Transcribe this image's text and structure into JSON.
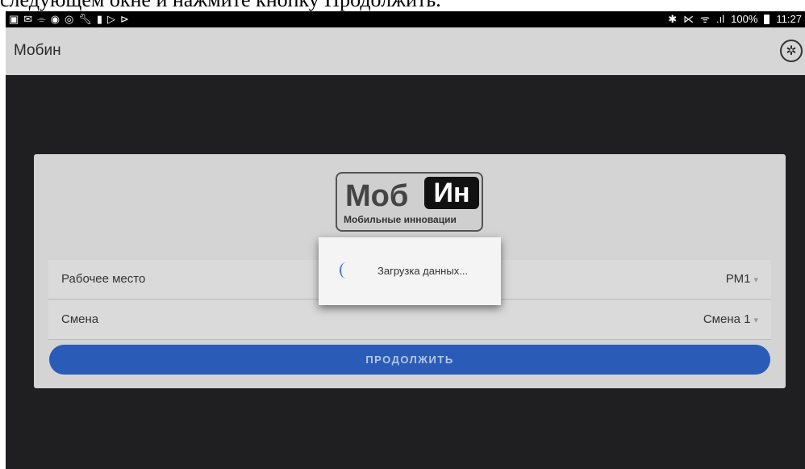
{
  "doc_caption": "следующем окне и нажмите кнопку Продолжить.",
  "status_bar": {
    "left_icons": [
      "gallery-icon",
      "mail-icon",
      "usb-icon",
      "yandex-icon",
      "target-icon",
      "wrench-icon",
      "person-icon",
      "play-outline-icon",
      "play-icon"
    ],
    "bluetooth": "✱",
    "mute": "⋉",
    "wifi": "ᯤ",
    "signal": ".ıl",
    "battery_text": "100%",
    "time": "11:27"
  },
  "app_bar": {
    "title": "Мобин",
    "settings_glyph": "✲"
  },
  "logo": {
    "main": "Моб",
    "highlight": "Ин",
    "subtitle": "Мобильные инновации"
  },
  "form": {
    "workplace_label": "Рабочее место",
    "workplace_value": "РМ1",
    "shift_label": "Смена",
    "shift_value": "Смена 1",
    "caret": "▾",
    "continue_label": "ПРОДОЛЖИТЬ"
  },
  "dialog": {
    "text": "Загрузка данных..."
  },
  "colors": {
    "accent": "#2a5cb7",
    "spinner": "#3d7ae0",
    "background": "#1f1f22"
  }
}
